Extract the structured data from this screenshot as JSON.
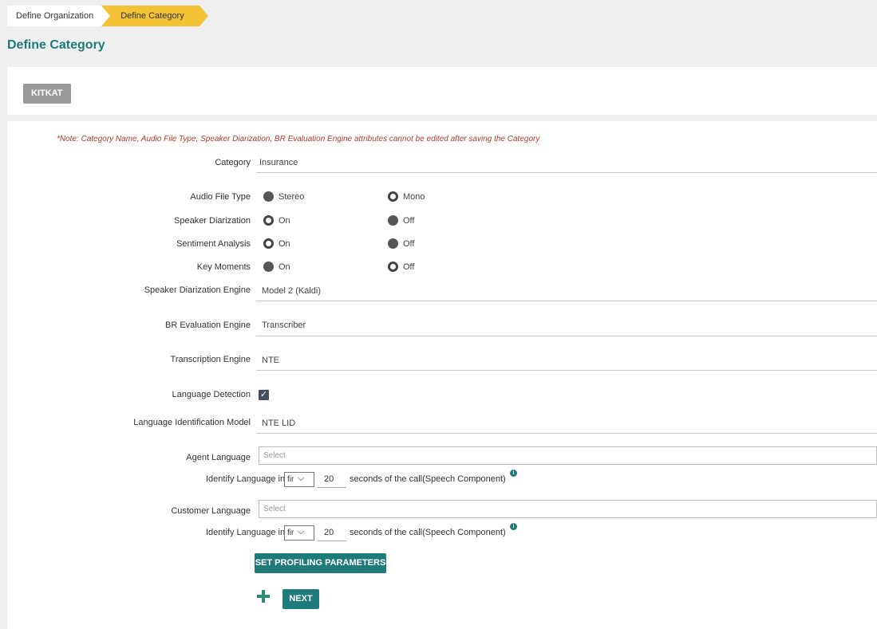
{
  "breadcrumb": {
    "items": [
      "Define Organization",
      "Define Category"
    ]
  },
  "page_title": "Define Category",
  "organization": {
    "name": "KITKAT"
  },
  "note": "*Note: Category Name, Audio File Type, Speaker Diarization, BR Evaluation Engine attributes cannot be edited after saving the Category",
  "fields": {
    "category": {
      "label": "Category",
      "value": "Insurance"
    },
    "audio_file_type": {
      "label": "Audio File Type",
      "options": [
        "Stereo",
        "Mono"
      ],
      "selected": "Mono"
    },
    "speaker_diarization": {
      "label": "Speaker Diarization",
      "options": [
        "On",
        "Off"
      ],
      "selected": "On"
    },
    "sentiment_analysis": {
      "label": "Sentiment Analysis",
      "options": [
        "On",
        "Off"
      ],
      "selected": "On"
    },
    "key_moments": {
      "label": "Key Moments",
      "options": [
        "On",
        "Off"
      ],
      "selected": "Off"
    },
    "speaker_diarization_engine": {
      "label": "Speaker Diarization Engine",
      "value": "Model 2 (Kaldi)"
    },
    "br_evaluation_engine": {
      "label": "BR Evaluation Engine",
      "value": "Transcriber"
    },
    "transcription_engine": {
      "label": "Transcription Engine",
      "value": "NTE"
    },
    "language_detection": {
      "label": "Language Detection",
      "checked": true
    },
    "language_identification_model": {
      "label": "Language Identification Model",
      "value": "NTE LID"
    },
    "agent_language": {
      "label": "Agent Language",
      "placeholder": "Select"
    },
    "customer_language": {
      "label": "Customer Language",
      "placeholder": "Select"
    }
  },
  "identify": {
    "prefix": "Identify Language in",
    "position": "fir",
    "seconds": "20",
    "suffix": "seconds of the call(Speech Component)",
    "info_icon": "info-icon"
  },
  "buttons": {
    "profiling": "SET PROFILING PARAMETERS",
    "next": "NEXT",
    "add_icon": "plus-icon"
  },
  "colors": {
    "accent": "#1f7a7a",
    "breadcrumb_active": "#f5c235",
    "note": "#b03a2e"
  }
}
